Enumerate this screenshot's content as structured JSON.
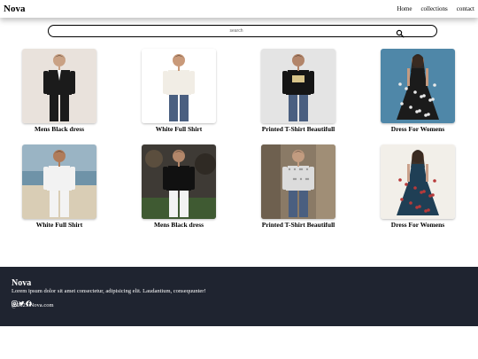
{
  "header": {
    "brand": "Nova",
    "nav": [
      "Home",
      "collections",
      "contact"
    ]
  },
  "search": {
    "placeholder": "search",
    "icon": "search-icon"
  },
  "products": [
    {
      "name": "Mens Black dress",
      "image": "man-black-suit",
      "colors": {
        "bg": "#e9e2dc",
        "body": "#1b1b1b",
        "skin": "#c9a184",
        "accent": "#ffffff"
      }
    },
    {
      "name": "White Full Shirt",
      "image": "man-white-shirt",
      "colors": {
        "bg": "#ffffff",
        "body": "#f1ede5",
        "skin": "#c99a7a",
        "accent": "#4a5f80"
      }
    },
    {
      "name": "Printed T-Shirt Beautifull",
      "image": "man-printed-tshirt",
      "colors": {
        "bg": "#e4e4e4",
        "body": "#151515",
        "skin": "#b2856a",
        "accent": "#5b7393"
      }
    },
    {
      "name": "Dress For Womens",
      "image": "woman-floral-dress",
      "colors": {
        "bg": "#4f87a8",
        "body": "#1b1b1b",
        "skin": "#c49a80",
        "accent": "#e9e9e9"
      }
    },
    {
      "name": "White Full Shirt",
      "image": "man-white-shirt-beach",
      "colors": {
        "bg": "#9ab4c4",
        "body": "#f2f2f2",
        "skin": "#b07c5a",
        "accent": "#c8b89a"
      }
    },
    {
      "name": "Mens Black dress",
      "image": "man-black-shirt",
      "colors": {
        "bg": "#3e3a35",
        "body": "#111111",
        "skin": "#b3876a",
        "accent": "#e9e6e0"
      }
    },
    {
      "name": "Printed T-Shirt Beautifull",
      "image": "man-patterned-tshirt",
      "colors": {
        "bg": "#8a7a66",
        "body": "#dcdcdc",
        "skin": "#c29c80",
        "accent": "#5b7393"
      }
    },
    {
      "name": "Dress For Womens",
      "image": "woman-long-floral-dress",
      "colors": {
        "bg": "#f2efe9",
        "body": "#1f3f55",
        "skin": "#c9a08a",
        "accent": "#b83a3a"
      }
    }
  ],
  "footer": {
    "brand": "Nova",
    "text": "Lorem ipsum dolor sit amet consectetur, adipisicing elit. Laudantium, consequunter!",
    "icons": [
      "instagram-icon",
      "twitter-icon",
      "facebook-icon"
    ],
    "copyright": "@2025 Nova.com"
  }
}
